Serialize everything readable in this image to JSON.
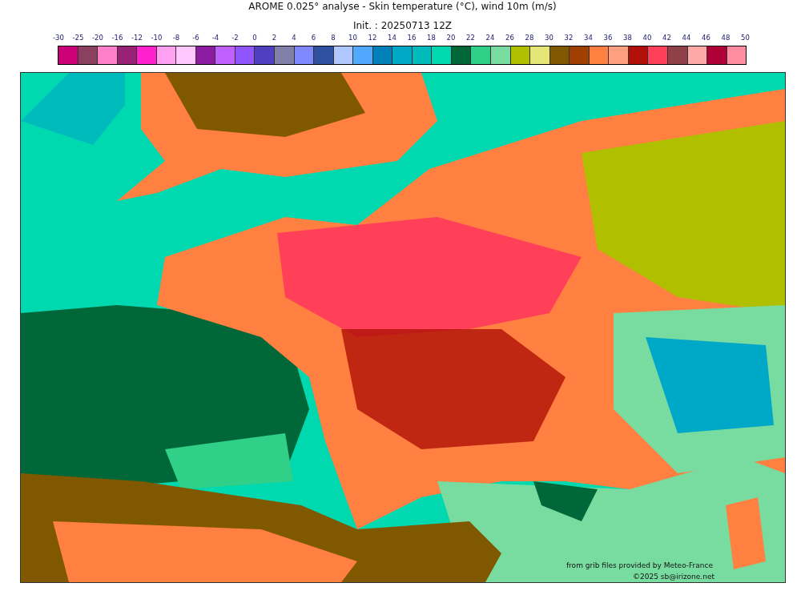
{
  "title": "AROME 0.025° analyse - Skin temperature (°C), wind 10m (m/s)",
  "subtitle": "Init. : 20250713 12Z",
  "colorbar": {
    "ticks": [
      "-30",
      "-25",
      "-20",
      "-16",
      "-12",
      "-10",
      "-8",
      "-6",
      "-4",
      "-2",
      "0",
      "2",
      "4",
      "6",
      "8",
      "10",
      "12",
      "14",
      "16",
      "18",
      "20",
      "22",
      "24",
      "26",
      "28",
      "30",
      "32",
      "34",
      "36",
      "38",
      "40",
      "42",
      "44",
      "46",
      "48",
      "50"
    ],
    "swatches": [
      {
        "color": "#cc0077"
      },
      {
        "color": "#8b4060"
      },
      {
        "color": "#ff80c8"
      },
      {
        "color": "#992277"
      },
      {
        "color": "#ff22cc"
      },
      {
        "color": "#ffa0f0"
      },
      {
        "color": "#ffc8ff"
      },
      {
        "color": "#8c1ca0"
      },
      {
        "color": "#c060ff"
      },
      {
        "color": "#9055ff"
      },
      {
        "color": "#5040c0"
      },
      {
        "color": "#8080a8"
      },
      {
        "color": "#8088ff"
      },
      {
        "color": "#3050a0"
      },
      {
        "color": "#b0c8ff"
      },
      {
        "color": "#50a8ff"
      },
      {
        "color": "#0080b8"
      },
      {
        "color": "#00a8c8"
      },
      {
        "color": "#00bbbb"
      },
      {
        "color": "#00d8b0"
      },
      {
        "color": "#006838"
      },
      {
        "color": "#30d088"
      },
      {
        "color": "#78dca0"
      },
      {
        "color": "#b0c000"
      },
      {
        "color": "#e6e678"
      },
      {
        "color": "#805800"
      },
      {
        "color": "#a04000"
      },
      {
        "color": "#ff8040"
      },
      {
        "color": "#ffa080"
      },
      {
        "color": "#b01008"
      },
      {
        "color": "#ff4058"
      },
      {
        "color": "#904048"
      },
      {
        "color": "#ffa8a8"
      },
      {
        "color": "#b00038"
      },
      {
        "color": "#ff8ca0"
      }
    ]
  },
  "credits": [
    "from grib files provided by Meteo-France",
    "©2025 sb@irizone.net"
  ]
}
